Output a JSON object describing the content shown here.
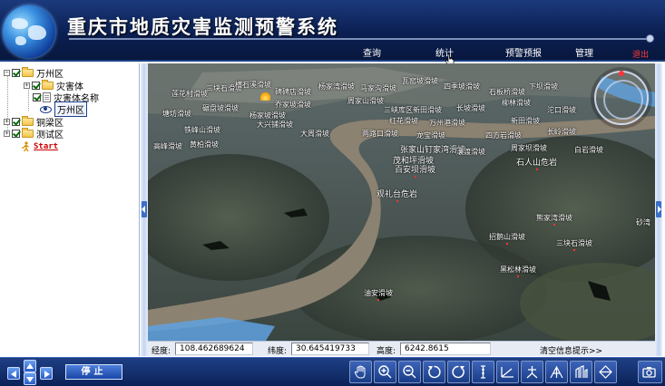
{
  "header": {
    "title": "重庆市地质灾害监测预警系统",
    "menu": {
      "query": "查询",
      "stats": "统计",
      "warning": "预警预报",
      "manage": "管理",
      "exit": "退出"
    }
  },
  "sidebar": {
    "tree": {
      "wanzhou": "万州区",
      "hazard": "灾害体",
      "hazard_name": "灾害体名称",
      "wanzhou_view": "万州区",
      "tongliang": "铜梁区",
      "test": "测试区",
      "start": "Start"
    }
  },
  "map": {
    "labels": [
      "莲花村滑坡",
      "三块石滑坡",
      "横石溪滑坡",
      "碑碑店滑坡",
      "杨家湾滑坡",
      "马家沟滑坡",
      "瓦窑坡滑坡",
      "四季坡滑坡",
      "石板桥滑坡",
      "下坝滑坡",
      "乔家坡滑坡",
      "周家山滑坡",
      "三峡库区新田滑坡",
      "长坡滑坡",
      "塘坊滑坡",
      "碾盘坡滑坡",
      "杨家坡滑坡",
      "柳林滑坡",
      "沱口滑坡",
      "大兴铺滑坡",
      "红花滑坡",
      "万州港滑坡",
      "新田滑坡",
      "铁峰山滑坡",
      "大周滑坡",
      "两路口滑坡",
      "龙宝滑坡",
      "四方岩滑坡",
      "长岭滑坡",
      "黄柏滑坡",
      "高峰滑坡",
      "张家山钉家湾滑坡",
      "瀼渡滑坡",
      "周家坝滑坡",
      "白岩滑坡",
      "石人山危岩",
      "茂和坪滑坡",
      "百安坝滑坡",
      "观礼台危岩",
      "熊家湾滑坡",
      "招鹅山滑坡",
      "三块石滑坡",
      "黑松林滑坡",
      "油安滑坡",
      "砂湾"
    ],
    "colors": {
      "water": "#8c8271",
      "terrain": "#3b4540",
      "river_blue": "#5fa2e0"
    }
  },
  "status": {
    "lon_label": "经度:",
    "lon_value": "108.462689624",
    "lat_label": "纬度:",
    "lat_value": "30.645419733",
    "alt_label": "高度:",
    "alt_value": "6242.8615",
    "clear_tips": "清空信息提示>>"
  },
  "toolbar": {
    "stop_label": "停止",
    "tools": [
      "pan-hand-icon",
      "zoom-in-icon",
      "zoom-out-icon",
      "rotate-left-icon",
      "rotate-right-icon",
      "measure-height-icon",
      "measure-distance-icon",
      "measure-area-icon",
      "draw-polygon-icon",
      "profile-icon",
      "plane-icon",
      "camera-icon"
    ]
  }
}
